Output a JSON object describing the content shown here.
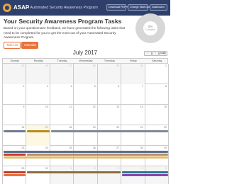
{
  "header": {
    "brand": "ASAP",
    "subtitle": "| Automated Security Awareness Program",
    "buttons": [
      "Download PDF ▾",
      "Change Start Date",
      "Dashboard"
    ]
  },
  "page": {
    "title": "Your Security Awareness Program Tasks",
    "intro": "Based on your questionnaire feedback, we have generated the following tasks that need to be completed for you to get the most out of your Automated Security Awareness Program"
  },
  "progress": {
    "percent_label": "0%",
    "caption": "Complete",
    "value": 0
  },
  "view_tabs": [
    "Task List",
    "Calendar"
  ],
  "calendar": {
    "month_title": "July 2017",
    "nav": {
      "prev": "‹",
      "next": "›",
      "today": "today"
    },
    "weekdays": [
      "Sunday",
      "Monday",
      "Tuesday",
      "Wednesday",
      "Thursday",
      "Friday",
      "Saturday"
    ],
    "weeks": [
      {
        "days": [
          "25",
          "26",
          "27",
          "28",
          "29",
          "30",
          "1"
        ],
        "other": [
          1,
          1,
          1,
          1,
          1,
          1,
          0
        ]
      },
      {
        "days": [
          "2",
          "3",
          "4",
          "5",
          "6",
          "7",
          "8"
        ],
        "other": [
          0,
          0,
          0,
          0,
          0,
          0,
          0
        ]
      },
      {
        "days": [
          "9",
          "10",
          "11",
          "12",
          "13",
          "14",
          "15"
        ],
        "other": [
          0,
          0,
          0,
          0,
          0,
          0,
          0
        ]
      },
      {
        "days": [
          "16",
          "17",
          "18",
          "19",
          "20",
          "21",
          "22"
        ],
        "other": [
          0,
          0,
          0,
          0,
          0,
          0,
          0
        ]
      },
      {
        "days": [
          "23",
          "24",
          "25",
          "26",
          "27",
          "28",
          "29"
        ],
        "other": [
          0,
          0,
          0,
          0,
          0,
          0,
          0
        ]
      },
      {
        "days": [
          "30",
          "31",
          "1",
          "2",
          "3",
          "4",
          "5"
        ],
        "other": [
          0,
          0,
          1,
          1,
          1,
          1,
          1
        ]
      }
    ],
    "today": {
      "week": 3,
      "day": 1
    },
    "events": [
      {
        "week": 3,
        "start": 0,
        "span": 1,
        "row": 0,
        "color": "#6d7b8d",
        "label": ""
      },
      {
        "week": 3,
        "start": 1,
        "span": 1,
        "row": 0,
        "color": "#b88a1e",
        "label": ""
      },
      {
        "week": 3,
        "start": 2,
        "span": 5,
        "row": 0,
        "color": "#7e8896",
        "label": ""
      },
      {
        "week": 4,
        "start": 0,
        "span": 7,
        "row": 0,
        "color": "#5b6e8f",
        "label": ""
      },
      {
        "week": 4,
        "start": 0,
        "span": 1,
        "row": 1,
        "color": "#c0392b",
        "label": ""
      },
      {
        "week": 4,
        "start": 1,
        "span": 6,
        "row": 1,
        "color": "#b38c6a",
        "label": ""
      },
      {
        "week": 4,
        "start": 0,
        "span": 7,
        "row": 2,
        "color": "#e4b96a",
        "label": ""
      },
      {
        "week": 5,
        "start": 0,
        "span": 1,
        "row": 0,
        "color": "#c0392b",
        "label": ""
      },
      {
        "week": 5,
        "start": 1,
        "span": 4,
        "row": 0,
        "color": "#8b6d3e",
        "label": ""
      },
      {
        "week": 5,
        "start": 5,
        "span": 2,
        "row": 0,
        "color": "#1f7a8c",
        "label": ""
      },
      {
        "week": 5,
        "start": 0,
        "span": 1,
        "row": 1,
        "color": "#e8733b",
        "label": ""
      },
      {
        "week": 5,
        "start": 5,
        "span": 2,
        "row": 1,
        "color": "#8e44ad",
        "label": ""
      }
    ]
  }
}
